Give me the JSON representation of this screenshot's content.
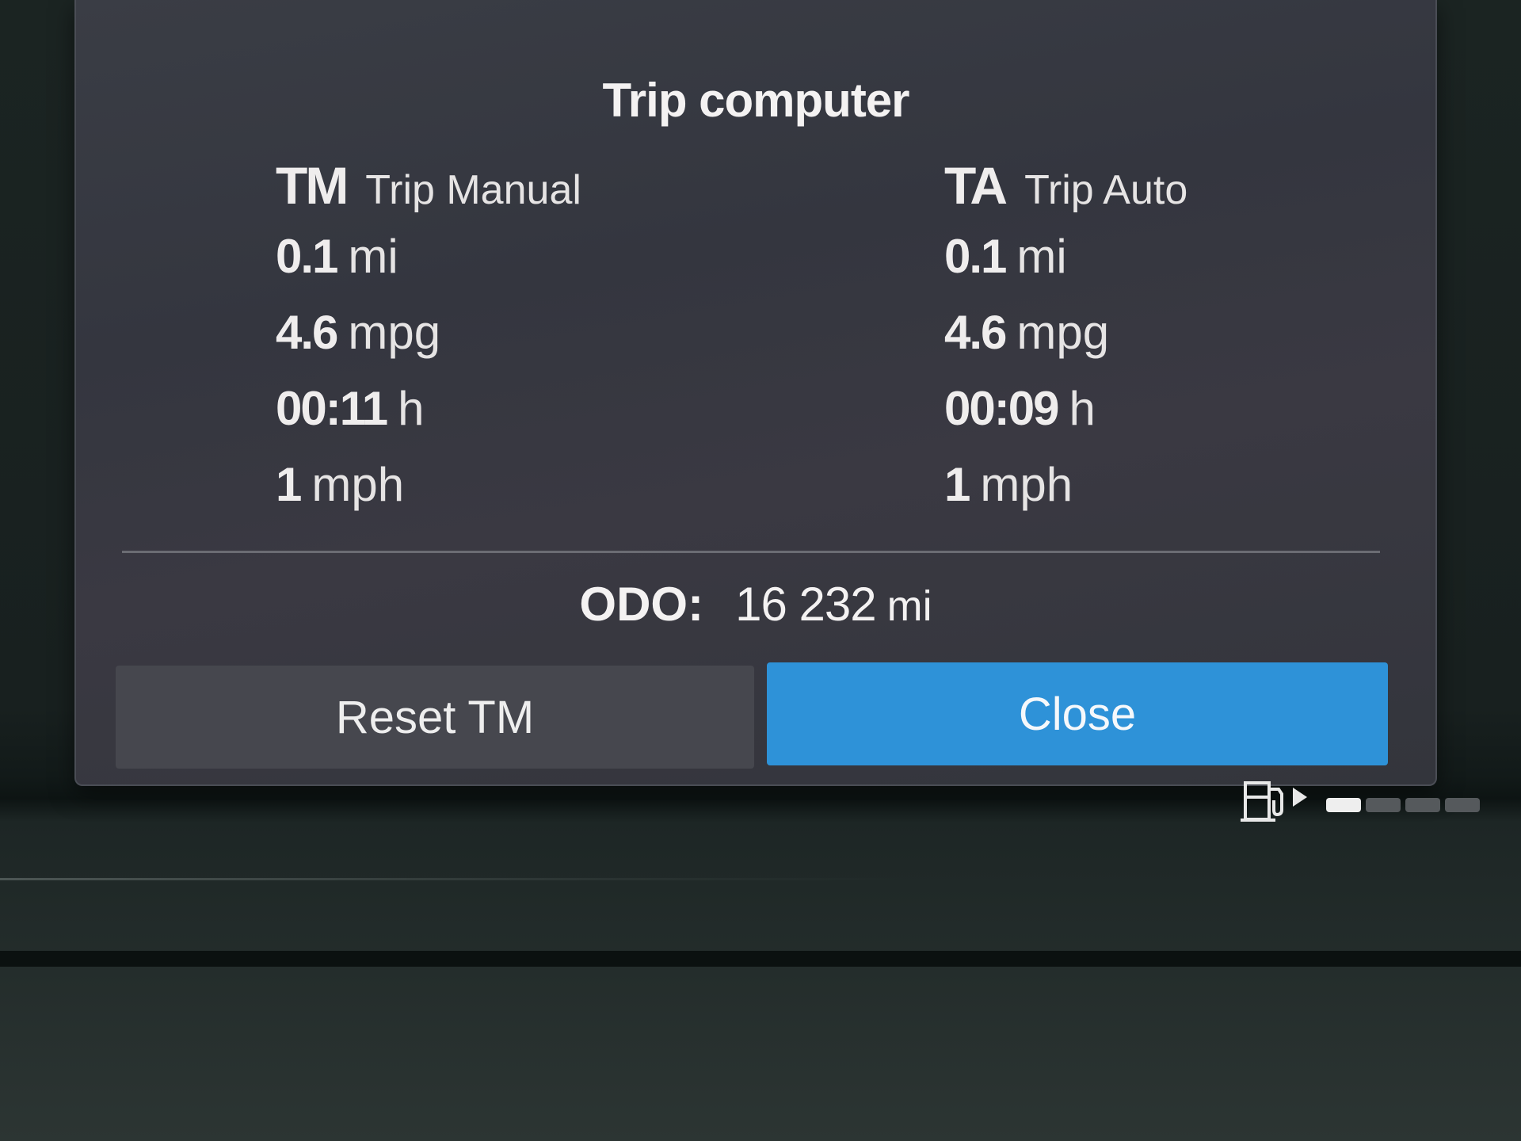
{
  "dialog": {
    "title": "Trip computer"
  },
  "trip_manual": {
    "abbr": "TM",
    "name": "Trip Manual",
    "distance": {
      "value": "0.1",
      "unit": "mi"
    },
    "consumption": {
      "value": "4.6",
      "unit": "mpg"
    },
    "time": {
      "value": "00:11",
      "unit": "h"
    },
    "speed": {
      "value": "1",
      "unit": "mph"
    }
  },
  "trip_auto": {
    "abbr": "TA",
    "name": "Trip Auto",
    "distance": {
      "value": "0.1",
      "unit": "mi"
    },
    "consumption": {
      "value": "4.6",
      "unit": "mpg"
    },
    "time": {
      "value": "00:09",
      "unit": "h"
    },
    "speed": {
      "value": "1",
      "unit": "mph"
    }
  },
  "odometer": {
    "label": "ODO:",
    "value": "16 232",
    "unit": "mi"
  },
  "buttons": {
    "reset_label": "Reset TM",
    "close_label": "Close"
  },
  "fuel_gauge": {
    "icon": "fuel-pump-icon",
    "level_fraction": 0.2
  },
  "colors": {
    "accent": "#2e92d8",
    "dialog_background": "#373943",
    "secondary_button": "#46474e"
  }
}
